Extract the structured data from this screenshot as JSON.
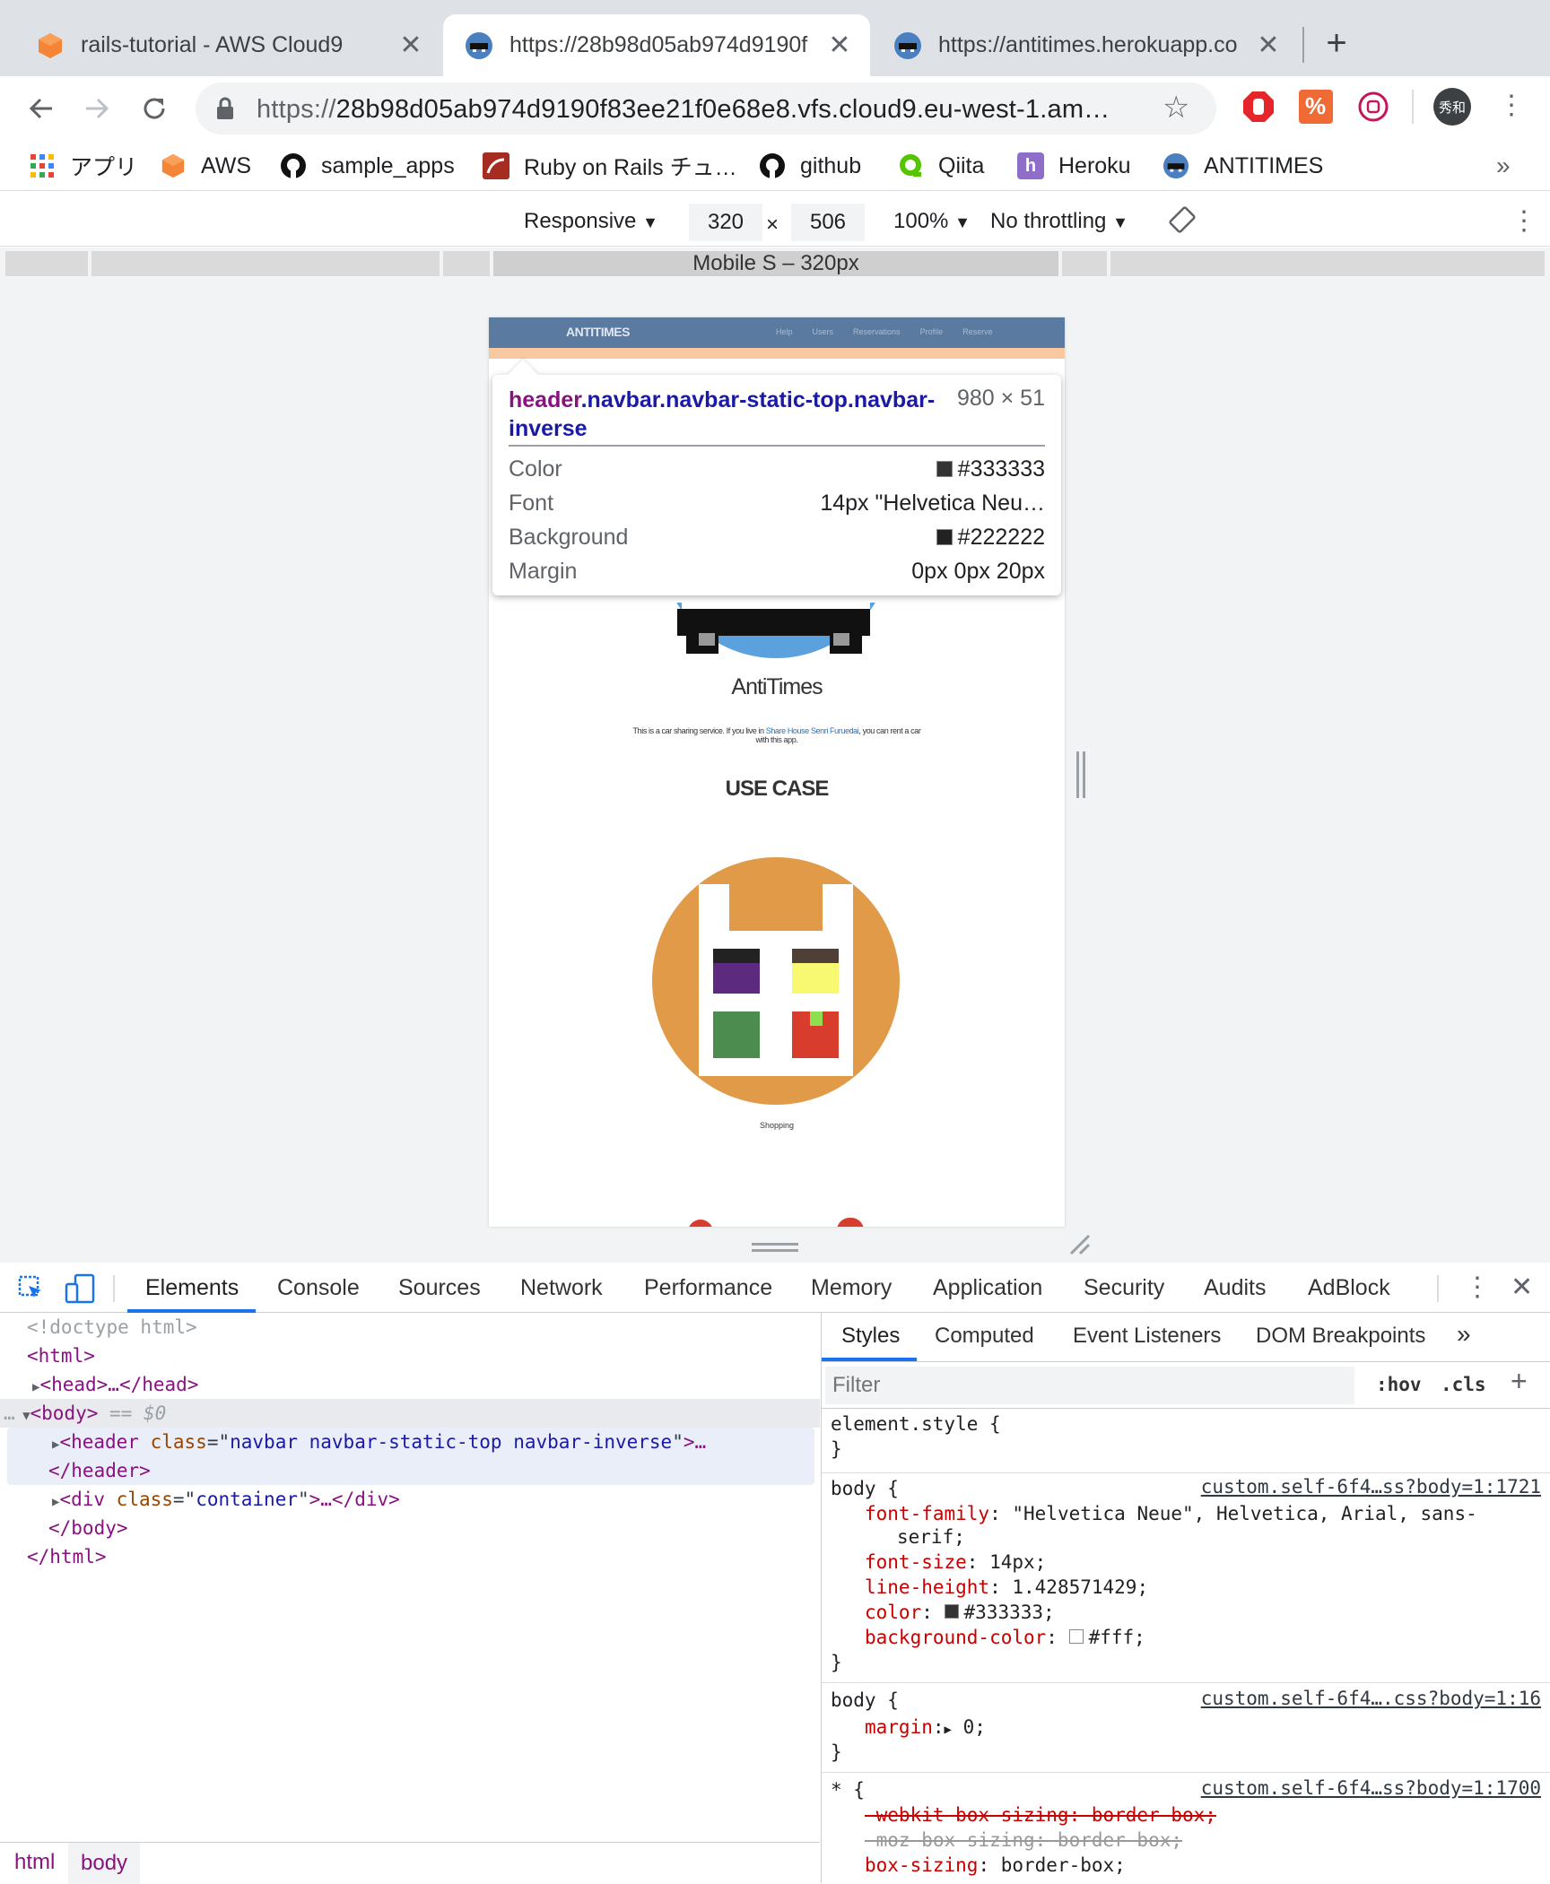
{
  "tabs": [
    {
      "title": "rails-tutorial - AWS Cloud9",
      "icon": "aws-cube-icon",
      "active": false
    },
    {
      "title": "https://28b98d05ab974d9190f",
      "icon": "car-favicon-icon",
      "active": true
    },
    {
      "title": "https://antitimes.herokuapp.co",
      "icon": "car-favicon-icon",
      "active": false
    }
  ],
  "toolbar": {
    "url_scheme": "https://",
    "url_rest": "28b98d05ab974d9190f83ee21f0e68e8.vfs.cloud9.eu-west-1.am…",
    "profile_label": "秀和"
  },
  "bookmarks": [
    {
      "label": "アプリ",
      "icon": "apps-grid-icon"
    },
    {
      "label": "AWS",
      "icon": "aws-cube-icon"
    },
    {
      "label": "sample_apps",
      "icon": "github-icon"
    },
    {
      "label": "Ruby on Rails チュ…",
      "icon": "rails-icon"
    },
    {
      "label": "github",
      "icon": "github-icon"
    },
    {
      "label": "Qiita",
      "icon": "qiita-icon"
    },
    {
      "label": "Heroku",
      "icon": "heroku-icon"
    },
    {
      "label": "ANTITIMES",
      "icon": "car-favicon-icon"
    }
  ],
  "bookmarks_overflow": "»",
  "device_toolbar": {
    "device": "Responsive",
    "width": "320",
    "times": "×",
    "height": "506",
    "zoom": "100%",
    "throttling": "No throttling",
    "media_query_label": "Mobile S – 320px"
  },
  "site": {
    "brand": "ANTITIMES",
    "nav_links": [
      "Help",
      "Users",
      "Reservations",
      "Profile",
      "Reserve"
    ],
    "title": "AntiTimes",
    "intro_pre": "This is a car sharing service. If you live in ",
    "intro_link": "Share House Senri Furuedai",
    "intro_post": ", you can rent a car",
    "intro_line2": "with this app.",
    "usecase_heading": "USE CASE",
    "shopping_caption": "Shopping"
  },
  "inspect_tooltip": {
    "selector_tag": "header",
    "selector_classes": ".navbar.navbar-static-top.navbar-inverse",
    "dimensions": "980 × 51",
    "rows": [
      {
        "key": "Color",
        "value": "#333333",
        "swatch": "#333333"
      },
      {
        "key": "Font",
        "value": "14px \"Helvetica Neu…",
        "swatch": ""
      },
      {
        "key": "Background",
        "value": "#222222",
        "swatch": "#222222"
      },
      {
        "key": "Margin",
        "value": "0px 0px 20px",
        "swatch": ""
      }
    ]
  },
  "devtools": {
    "tabs": [
      "Elements",
      "Console",
      "Sources",
      "Network",
      "Performance",
      "Memory",
      "Application",
      "Security",
      "Audits",
      "AdBlock"
    ],
    "active_tab": "Elements",
    "dom": {
      "doctype": "<!doctype html>",
      "html_open": "<html>",
      "head": "<head>…</head>",
      "body_open": "<body>",
      "body_marker": "== $0",
      "header_tag": "<header",
      "header_attr": "class",
      "header_value": "navbar navbar-static-top navbar-inverse",
      "header_tail": ">…",
      "header_close": "</header>",
      "div_tag": "<div",
      "div_attr": "class",
      "div_value": "container",
      "div_tail": ">…</div>",
      "body_close": "</body>",
      "html_close": "</html>"
    },
    "breadcrumbs": [
      "html",
      "body"
    ],
    "styles_tabs": [
      "Styles",
      "Computed",
      "Event Listeners",
      "DOM Breakpoints"
    ],
    "styles_overflow": "»",
    "filter_placeholder": "Filter",
    "hov": ":hov",
    "cls": ".cls",
    "rules": {
      "element_style": "element.style {",
      "body1_selector": "body {",
      "body1_source": "custom.self-6f4…ss?body=1:1721",
      "body1_props": [
        {
          "name": "font-family",
          "value": "\"Helvetica Neue\", Helvetica, Arial, sans-"
        },
        {
          "name": "",
          "value": "serif;"
        },
        {
          "name": "font-size",
          "value": "14px;"
        },
        {
          "name": "line-height",
          "value": "1.428571429;"
        },
        {
          "name": "color",
          "value": "#333333;"
        },
        {
          "name": "background-color",
          "value": "#fff;"
        }
      ],
      "body2_selector": "body {",
      "body2_source": "custom.self-6f4….css?body=1:16",
      "body2_prop": "margin",
      "body2_value": "0;",
      "star_selector": "* {",
      "star_source": "custom.self-6f4…ss?body=1:1700",
      "star_props": [
        "-webkit-box-sizing: border-box;",
        "-moz-box-sizing: border-box;",
        "box-sizing: border-box;"
      ],
      "close_brace": "}"
    }
  },
  "colors": {
    "chrome_bg": "#dee1e6",
    "accent_blue": "#1a73e8",
    "site_navbar": "#5a7aa0",
    "site_orange": "#e09a48",
    "site_blue_circle": "#5ba1de"
  }
}
